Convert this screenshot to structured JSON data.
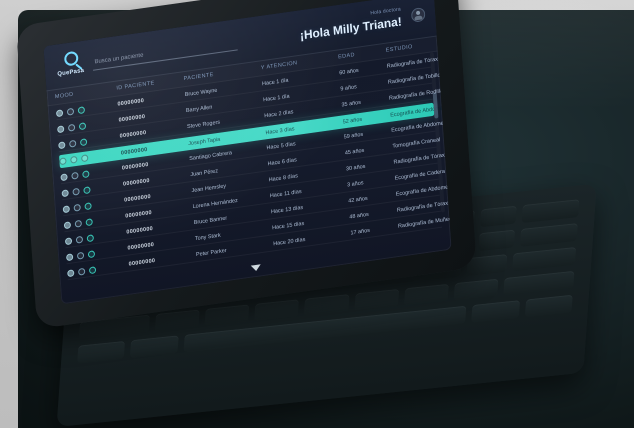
{
  "app": {
    "brand": "QuePasa",
    "search_placeholder": "Busca un paciente",
    "greeting_sub": "Hola doctora",
    "greeting_main": "¡Hola Milly Triana!"
  },
  "table": {
    "headers": [
      "MOOD",
      "ID PACIENTE",
      "PACIENTE",
      "Y ATENCIÓN",
      "EDAD",
      "ESTUDIO"
    ],
    "rows": [
      {
        "id": "00000000",
        "name": "Bruce Wayne",
        "time": "Hace 1 día",
        "age": "60 años",
        "study": "Radiografía de Tórax",
        "mood": [
          "filled",
          "ring",
          "teal"
        ]
      },
      {
        "id": "00000000",
        "name": "Barry Allen",
        "time": "Hace 1 día",
        "age": "9 años",
        "study": "Radiografía de Tobillo",
        "mood": [
          "filled",
          "ring",
          "teal"
        ]
      },
      {
        "id": "00000000",
        "name": "Steve Rogers",
        "time": "Hace 2 días",
        "age": "35 años",
        "study": "Radiografía de Rodilla",
        "mood": [
          "filled",
          "ring",
          "teal"
        ]
      },
      {
        "id": "00000000",
        "name": "Joseph Tapia",
        "time": "Hace 3 días",
        "age": "52 años",
        "study": "Ecografía de Abdomen",
        "mood": [
          "filled",
          "ring",
          "teal"
        ],
        "selected": true
      },
      {
        "id": "00000000",
        "name": "Santiago Cabrera",
        "time": "Hace 5 días",
        "age": "59 años",
        "study": "Ecografía de Abdomen",
        "mood": [
          "filled",
          "ring",
          "teal"
        ]
      },
      {
        "id": "00000000",
        "name": "Juan Pérez",
        "time": "Hace 6 días",
        "age": "45 años",
        "study": "Tomografía Craneal",
        "mood": [
          "filled",
          "ring",
          "teal"
        ]
      },
      {
        "id": "00000000",
        "name": "Jean Hemsley",
        "time": "Hace 8 días",
        "age": "30 años",
        "study": "Radiografía de Tórax",
        "mood": [
          "filled",
          "ring",
          "teal"
        ]
      },
      {
        "id": "00000000",
        "name": "Lorena Hernández",
        "time": "Hace 11 días",
        "age": "3 años",
        "study": "Ecografía de Cadera",
        "mood": [
          "filled",
          "ring",
          "teal"
        ]
      },
      {
        "id": "00000000",
        "name": "Bruce Banner",
        "time": "Hace 13 días",
        "age": "42 años",
        "study": "Ecografía de Abdomen",
        "mood": [
          "filled",
          "ring",
          "teal"
        ]
      },
      {
        "id": "00000000",
        "name": "Tony Stark",
        "time": "Hace 15 días",
        "age": "48 años",
        "study": "Radiografía de Tórax",
        "mood": [
          "filled",
          "ring",
          "teal"
        ]
      },
      {
        "id": "00000000",
        "name": "Peter Parker",
        "time": "Hace 20 días",
        "age": "17 años",
        "study": "Radiografía de Muñeca",
        "mood": [
          "filled",
          "ring",
          "teal"
        ]
      }
    ]
  }
}
